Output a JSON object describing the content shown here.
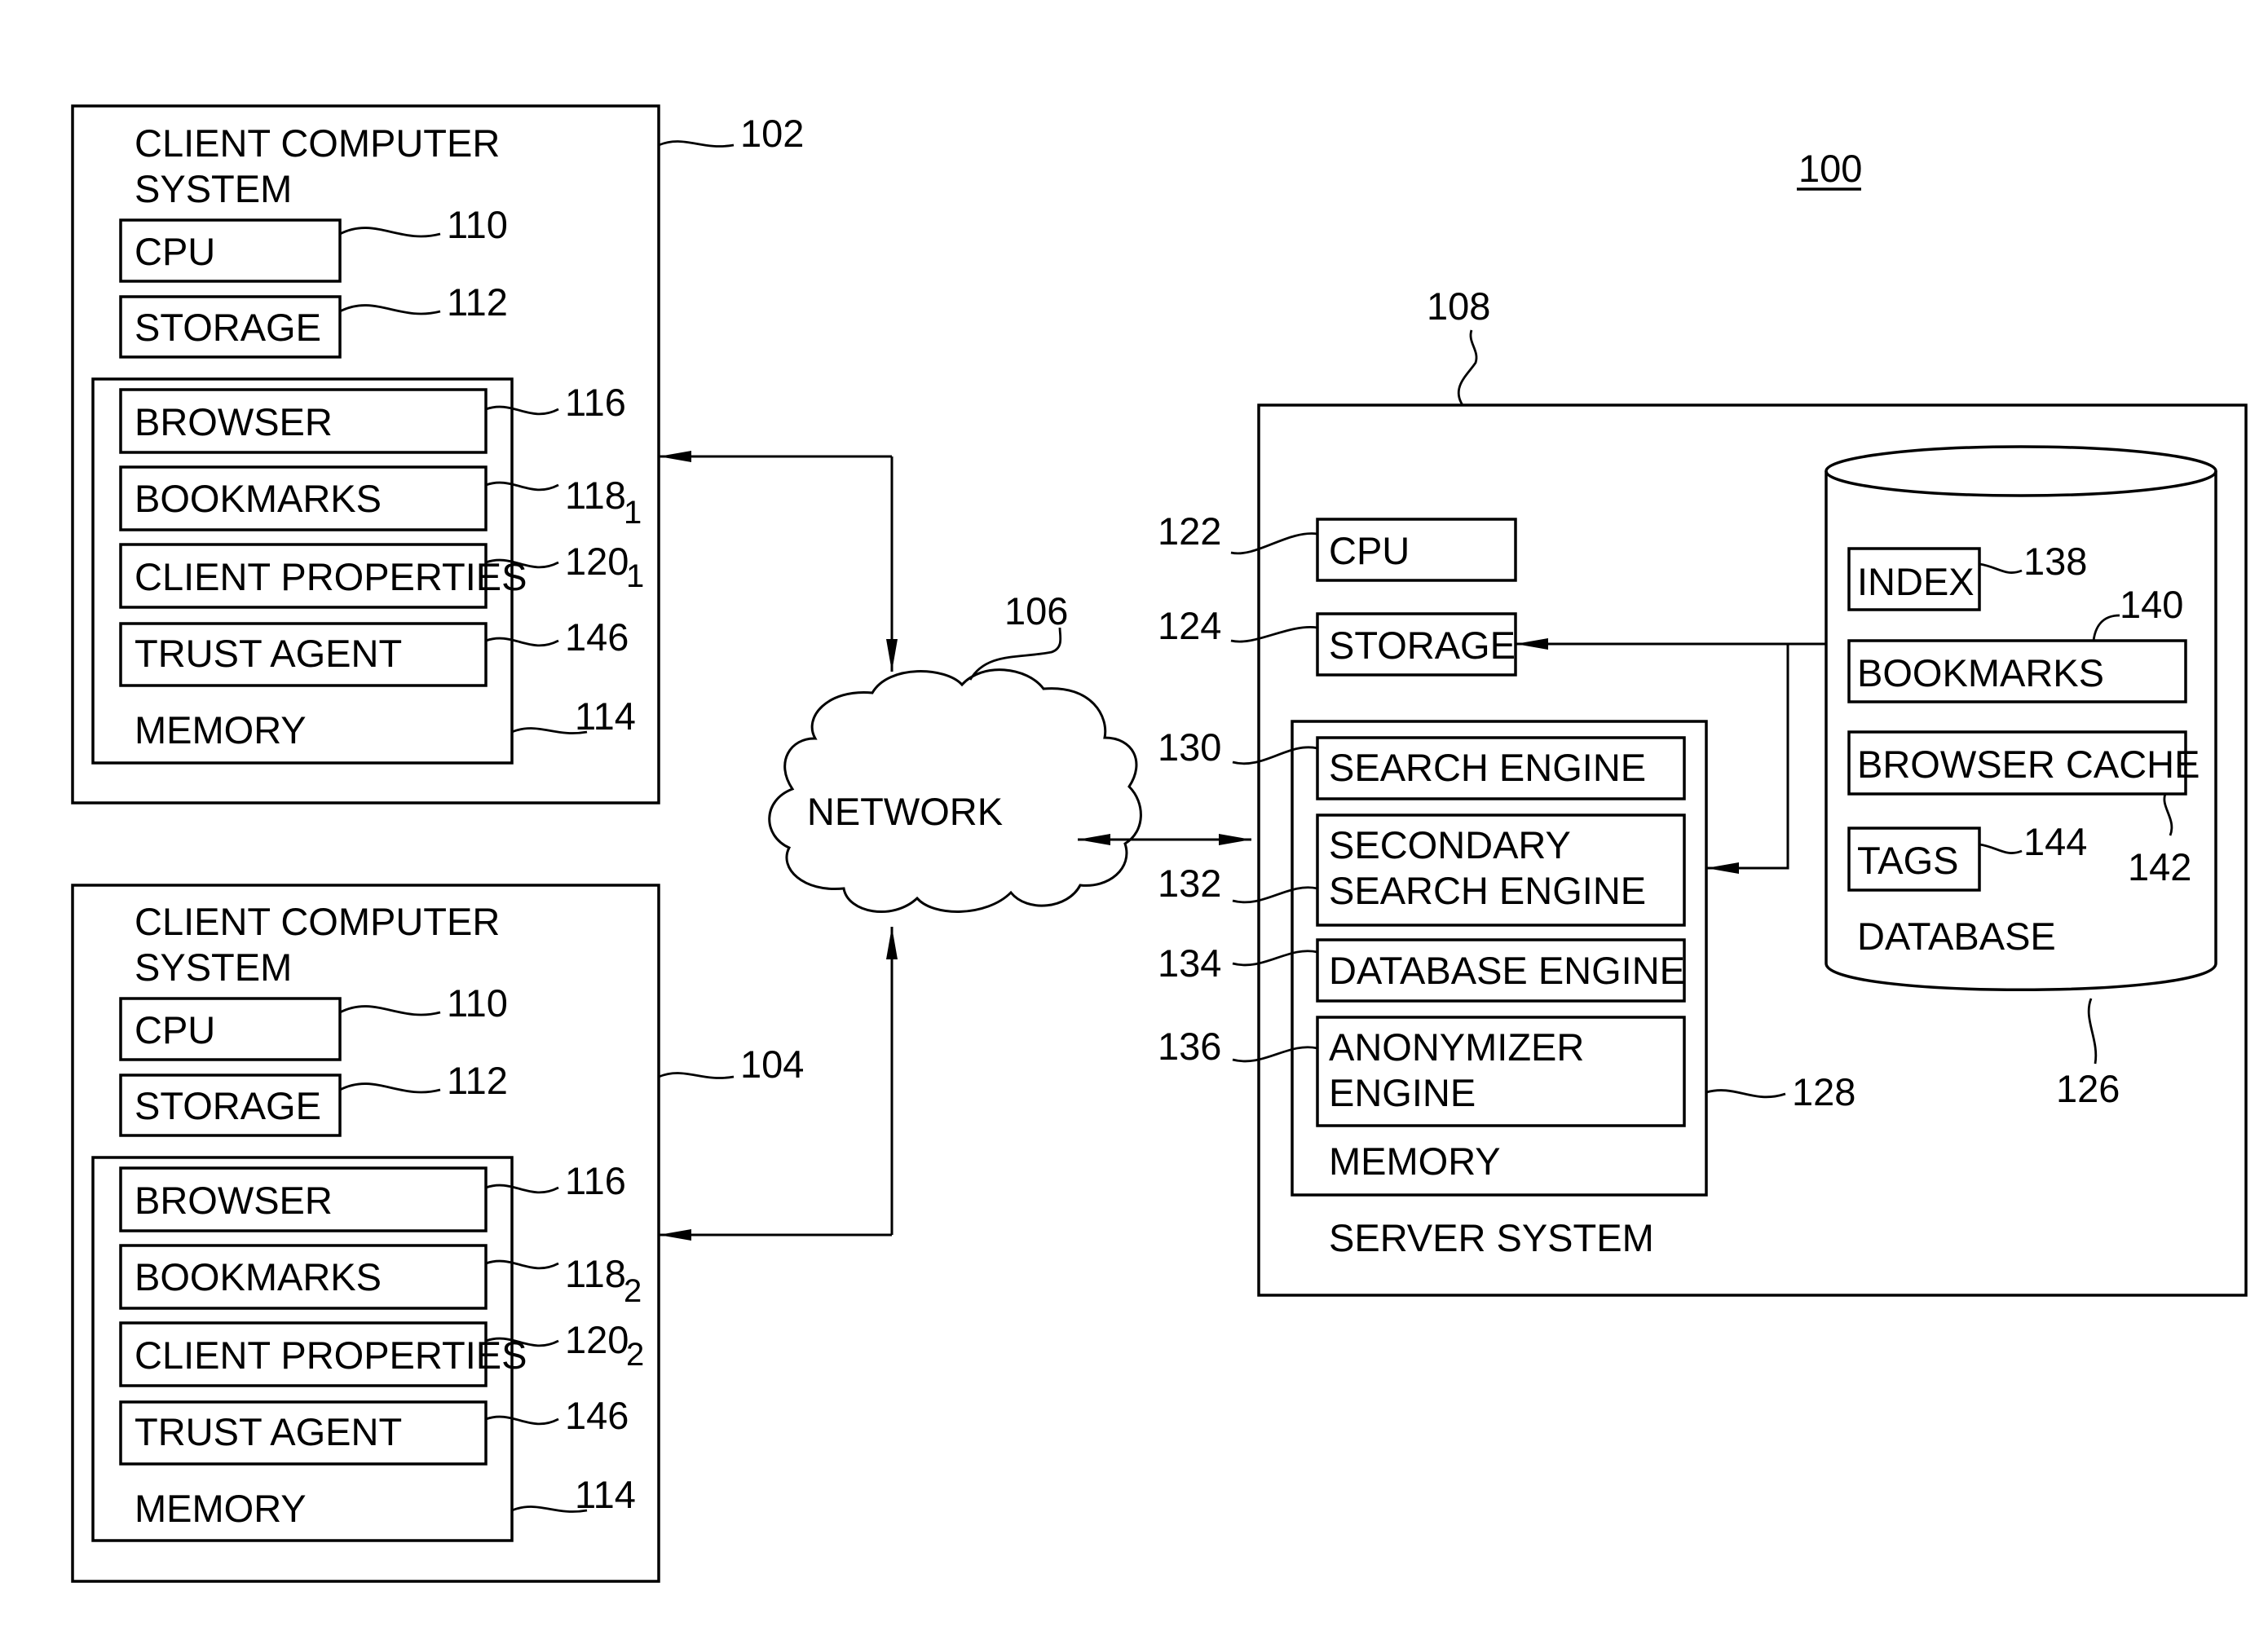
{
  "figure_ref": "100",
  "clients": [
    {
      "ref": "102",
      "title_line1": "CLIENT COMPUTER",
      "title_line2": "SYSTEM",
      "cpu": {
        "label": "CPU",
        "ref": "110"
      },
      "storage": {
        "label": "STORAGE",
        "ref": "112"
      },
      "memory": {
        "label": "MEMORY",
        "ref": "114",
        "browser": {
          "label": "BROWSER",
          "ref": "116"
        },
        "bookmarks": {
          "label": "BOOKMARKS",
          "ref": "118",
          "sub": "1"
        },
        "client_properties": {
          "label": "CLIENT PROPERTIES",
          "ref": "120",
          "sub": "1"
        },
        "trust_agent": {
          "label": "TRUST AGENT",
          "ref": "146"
        }
      }
    },
    {
      "ref": "104",
      "title_line1": "CLIENT COMPUTER",
      "title_line2": "SYSTEM",
      "cpu": {
        "label": "CPU",
        "ref": "110"
      },
      "storage": {
        "label": "STORAGE",
        "ref": "112"
      },
      "memory": {
        "label": "MEMORY",
        "ref": "114",
        "browser": {
          "label": "BROWSER",
          "ref": "116"
        },
        "bookmarks": {
          "label": "BOOKMARKS",
          "ref": "118",
          "sub": "2"
        },
        "client_properties": {
          "label": "CLIENT PROPERTIES",
          "ref": "120",
          "sub": "2"
        },
        "trust_agent": {
          "label": "TRUST AGENT",
          "ref": "146"
        }
      }
    }
  ],
  "network": {
    "label": "NETWORK",
    "ref": "106"
  },
  "server": {
    "ref": "108",
    "label": "SERVER SYSTEM",
    "cpu": {
      "label": "CPU",
      "ref": "122"
    },
    "storage": {
      "label": "STORAGE",
      "ref": "124"
    },
    "memory": {
      "label": "MEMORY",
      "ref": "128",
      "search_engine": {
        "label": "SEARCH ENGINE",
        "ref": "130"
      },
      "secondary_search_engine": {
        "line1": "SECONDARY",
        "line2": "SEARCH ENGINE",
        "ref": "132"
      },
      "database_engine": {
        "label": "DATABASE ENGINE",
        "ref": "134"
      },
      "anonymizer_engine": {
        "line1": "ANONYMIZER",
        "line2": "ENGINE",
        "ref": "136"
      }
    },
    "database": {
      "label": "DATABASE",
      "ref": "126",
      "index": {
        "label": "INDEX",
        "ref": "138"
      },
      "bookmarks": {
        "label": "BOOKMARKS",
        "ref": "140"
      },
      "browser_cache": {
        "label": "BROWSER CACHE",
        "ref": "142"
      },
      "tags": {
        "label": "TAGS",
        "ref": "144"
      }
    }
  }
}
